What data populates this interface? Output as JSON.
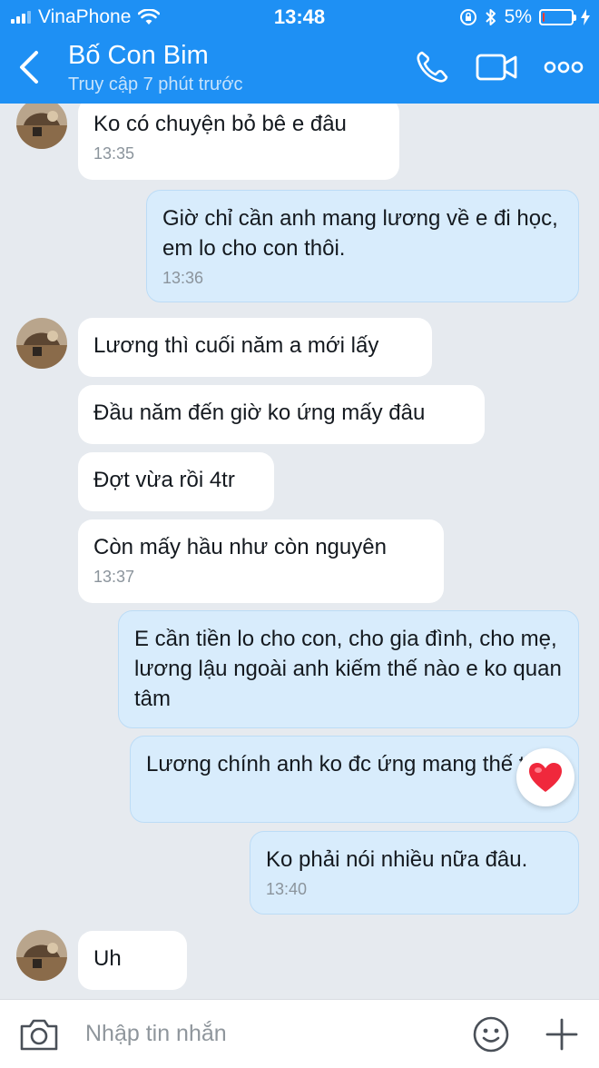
{
  "status_bar": {
    "carrier": "VinaPhone",
    "time": "13:48",
    "battery": "5%",
    "battery_level": 0.05
  },
  "header": {
    "contact_name": "Bố Con Bim",
    "last_seen": "Truy cập 7 phút trước",
    "icons": [
      "back-icon",
      "phone-icon",
      "video-call-icon",
      "more-icon"
    ]
  },
  "messages": [
    {
      "side": "incoming",
      "text": "Ko có chuyện bỏ bê e đâu",
      "time": "13:35"
    },
    {
      "side": "outgoing",
      "text": "Giờ chỉ cần anh mang lương về e đi học, em lo cho con thôi.",
      "time": "13:36"
    },
    {
      "side": "incoming",
      "text": "Lương thì cuối năm a mới lấy"
    },
    {
      "side": "incoming",
      "text": "Đầu năm đến giờ ko ứng mấy đâu"
    },
    {
      "side": "incoming",
      "text": "Đợt vừa rồi 4tr"
    },
    {
      "side": "incoming",
      "text": "Còn mấy hầu như còn nguyên",
      "time": "13:37"
    },
    {
      "side": "outgoing",
      "text": "E cần tiền lo cho con, cho gia đình, cho mẹ, lương lậu ngoài anh kiếm thế nào e ko quan tâm"
    },
    {
      "side": "outgoing",
      "text": "Lương chính anh ko đc ứng mang thế thôi",
      "reaction": "heart-icon"
    },
    {
      "side": "outgoing",
      "text": "Ko phải nói nhiều nữa đâu.",
      "time": "13:40"
    },
    {
      "side": "incoming",
      "text": "Uh"
    }
  ],
  "input": {
    "placeholder": "Nhập tin nhắn",
    "icons": [
      "camera-icon",
      "emoji-icon",
      "plus-icon"
    ]
  },
  "colors": {
    "header": "#1e90f4",
    "background": "#e6eaef",
    "incoming_bubble": "#ffffff",
    "outgoing_bubble": "#d8ecfc",
    "timestamp": "#8b949c"
  }
}
